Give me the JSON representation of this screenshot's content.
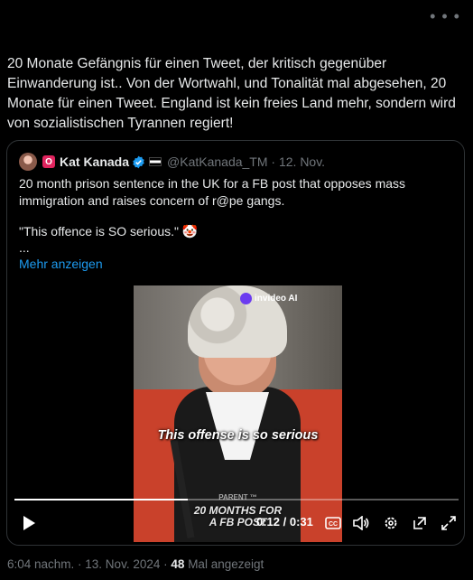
{
  "tweet": {
    "text": "20 Monate Gefängnis für einen Tweet, der kritisch gegenüber Einwanderung ist.. Von der Wortwahl, und Tonalität mal abgesehen, 20 Monate für einen Tweet. England ist kein freies Land mehr, sondern wird von sozialistischen Tyrannen regiert!",
    "more_icon": "more-horizontal-icon",
    "timestamp": "6:04 nachm. · 13. Nov. 2024",
    "dot": "·",
    "views": "48",
    "views_label": "Mal angezeigt"
  },
  "quote": {
    "badge": "O",
    "name": "Kat Kanada",
    "handle": "@KatKanada_TM · 12. Nov.",
    "text": "20 month prison sentence in the UK for a FB post that opposes mass immigration and raises concern of r@pe gangs.",
    "quote_line": "\"This offence is SO serious.\" 🤡",
    "ellipsis": "...",
    "show_more": "Mehr anzeigen",
    "verified_color": "#1d9bf0"
  },
  "video": {
    "watermark": "invideo AI",
    "caption": "This offense is so serious",
    "banner_small": "PARENT ™",
    "banner_line1": "20 MONTHS FOR",
    "banner_line2": "A FB POST",
    "time": "0:12 / 0:31",
    "progress": 0.39,
    "icons": [
      "play-icon",
      "captions-icon",
      "volume-icon",
      "settings-icon",
      "popout-icon",
      "fullscreen-icon"
    ]
  }
}
